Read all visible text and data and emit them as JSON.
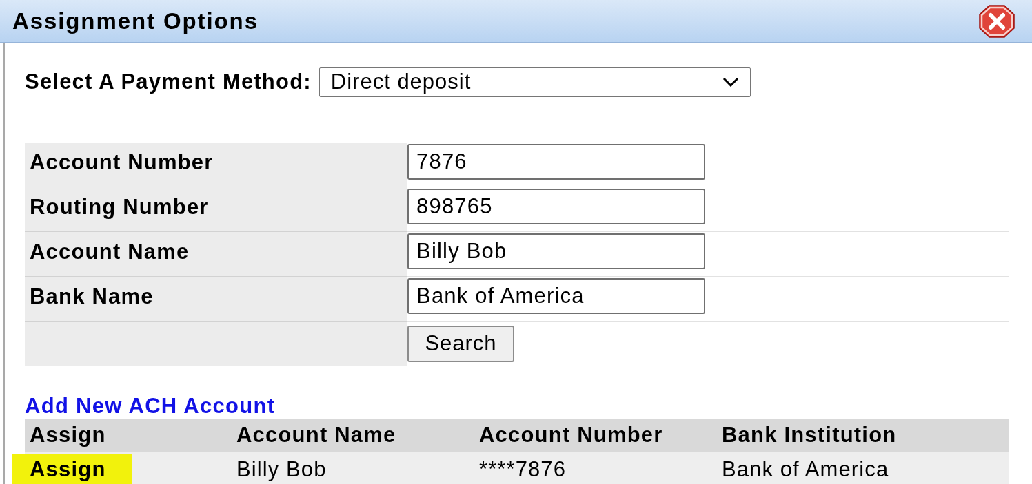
{
  "window": {
    "title": "Assignment Options"
  },
  "payment_method": {
    "label": "Select A Payment Method:",
    "value": "Direct deposit"
  },
  "search_form": {
    "fields": [
      {
        "label": "Account Number",
        "value": "7876"
      },
      {
        "label": "Routing Number",
        "value": "898765"
      },
      {
        "label": "Account Name",
        "value": "Billy Bob"
      },
      {
        "label": "Bank Name",
        "value": "Bank of America"
      }
    ],
    "button": "Search"
  },
  "add_link": "Add New ACH Account",
  "table": {
    "columns": [
      "Assign",
      "Account Name",
      "Account Number",
      "Bank Institution"
    ],
    "rows": [
      {
        "highlighted": true,
        "cells": [
          "Assign",
          "Billy Bob",
          "****7876",
          "Bank of America"
        ]
      }
    ]
  }
}
